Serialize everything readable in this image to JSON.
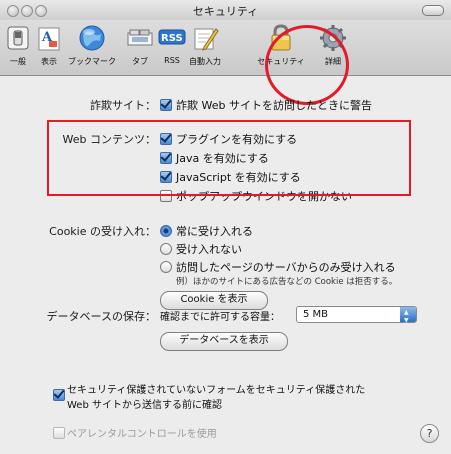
{
  "window": {
    "title": "セキュリティ"
  },
  "toolbar": {
    "items": [
      {
        "label": "一般",
        "icon": "switch-icon"
      },
      {
        "label": "表示",
        "icon": "font-icon"
      },
      {
        "label": "ブックマーク",
        "icon": "globe-icon"
      },
      {
        "label": "タブ",
        "icon": "tabs-icon"
      },
      {
        "label": "RSS",
        "icon": "rss-icon"
      },
      {
        "label": "自動入力",
        "icon": "pencil-icon"
      },
      {
        "label": "セキュリティ",
        "icon": "lock-icon"
      },
      {
        "label": "詳細",
        "icon": "gear-icon"
      }
    ],
    "rss_badge": "RSS",
    "selected": "セキュリティ"
  },
  "security": {
    "fraud_label": "詐欺サイト：",
    "fraud_checkbox": "詐欺 Web サイトを訪問したときに警告",
    "web_content_label": "Web コンテンツ：",
    "plugins": "プラグインを有効にする",
    "java": "Java を有効にする",
    "javascript": "JavaScript を有効にする",
    "popups": "ポップアップウインドウを開かない",
    "cookie_label": "Cookie の受け入れ：",
    "cookie_always": "常に受け入れる",
    "cookie_never": "受け入れない",
    "cookie_visited": "訪問したページのサーバからのみ受け入れる",
    "cookie_note": "例）ほかのサイトにある広告などの Cookie は拒否する。",
    "cookie_button": "Cookie を表示",
    "db_label": "データベースの保存：",
    "db_quota_label": "確認までに許可する容量：",
    "db_quota_value": "5 MB",
    "db_button": "データベースを表示",
    "insecure_form_line1": "セキュリティ保護されていないフォームをセキュリティ保護された",
    "insecure_form_line2": "Web サイトから送信する前に確認",
    "parental": "ペアレンタルコントロールを使用",
    "help": "?"
  },
  "colors": {
    "highlight": "#e21b2b",
    "accent": "#3d79c8"
  }
}
